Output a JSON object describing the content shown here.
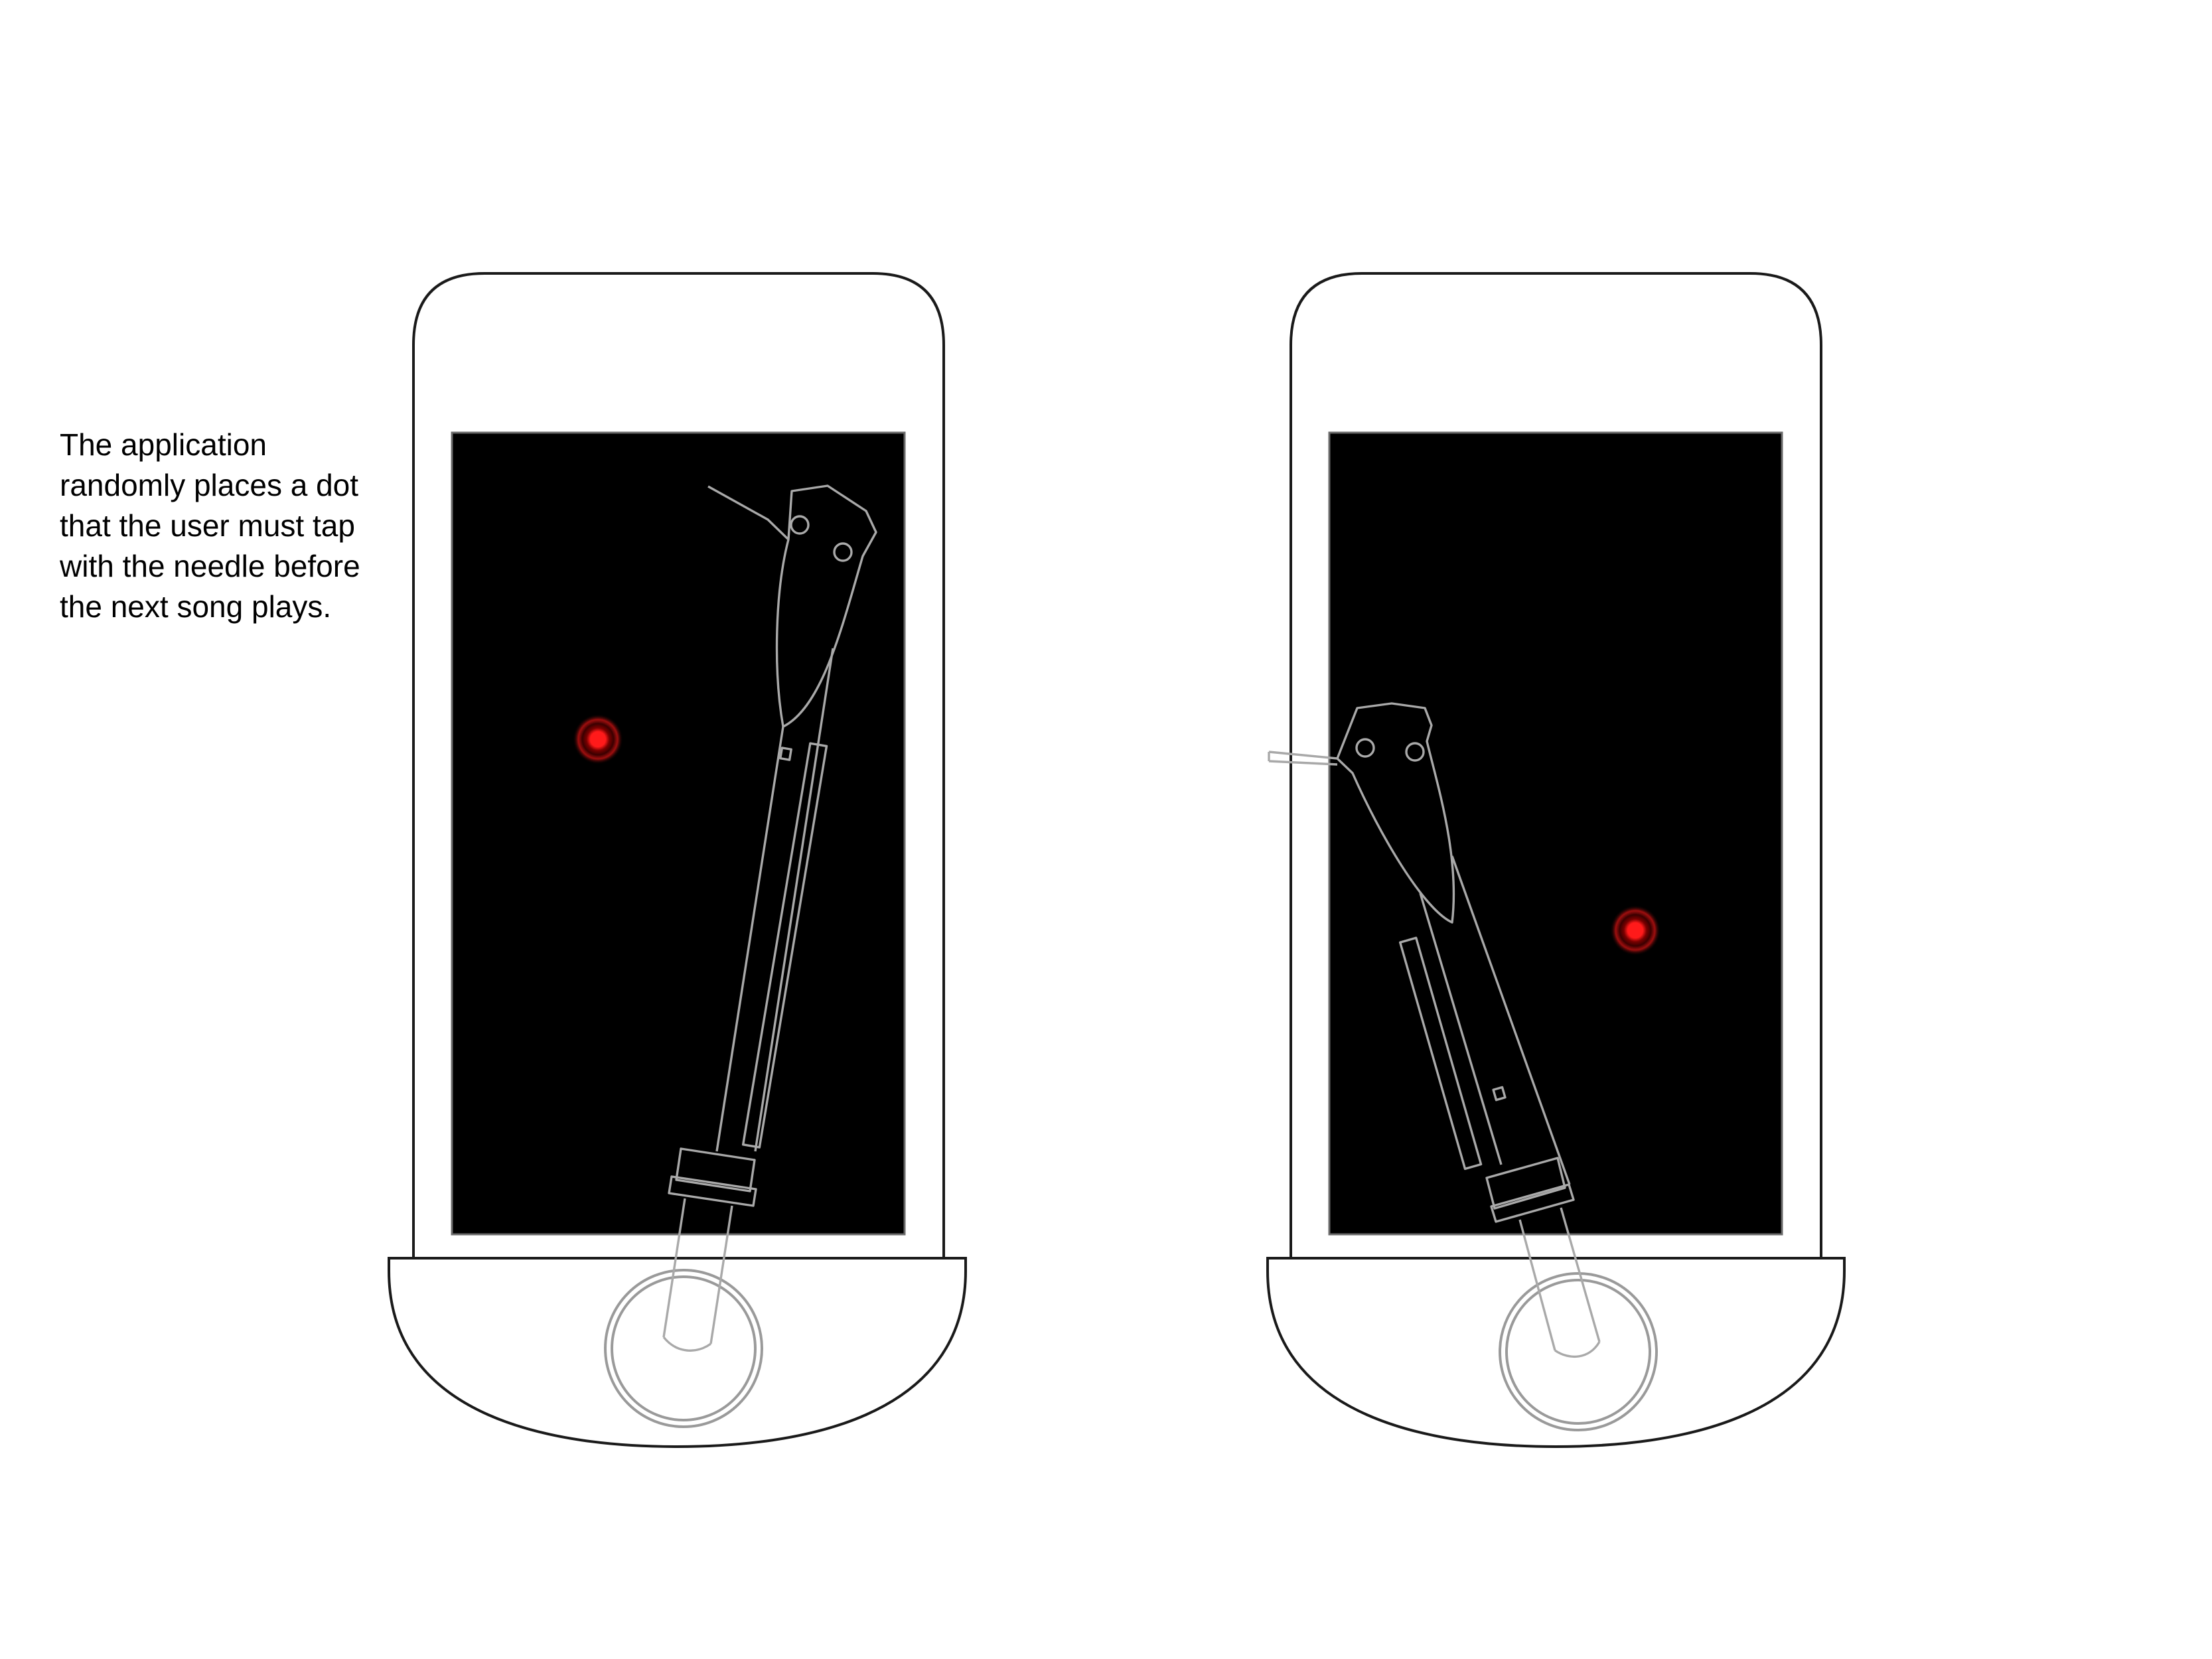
{
  "caption": "The application randomly places a dot that the user must tap with the needle before the next song plays.",
  "colors": {
    "dot": "#ff1a1a",
    "screen": "#000000",
    "needle_outline": "#a9a9a9",
    "phone_outline": "#1a1a1a"
  },
  "phones": [
    {
      "label": "phone-left",
      "needle": "tonearm-outline",
      "target": "red-dot"
    },
    {
      "label": "phone-right",
      "needle": "tonearm-outline",
      "target": "red-dot"
    }
  ]
}
